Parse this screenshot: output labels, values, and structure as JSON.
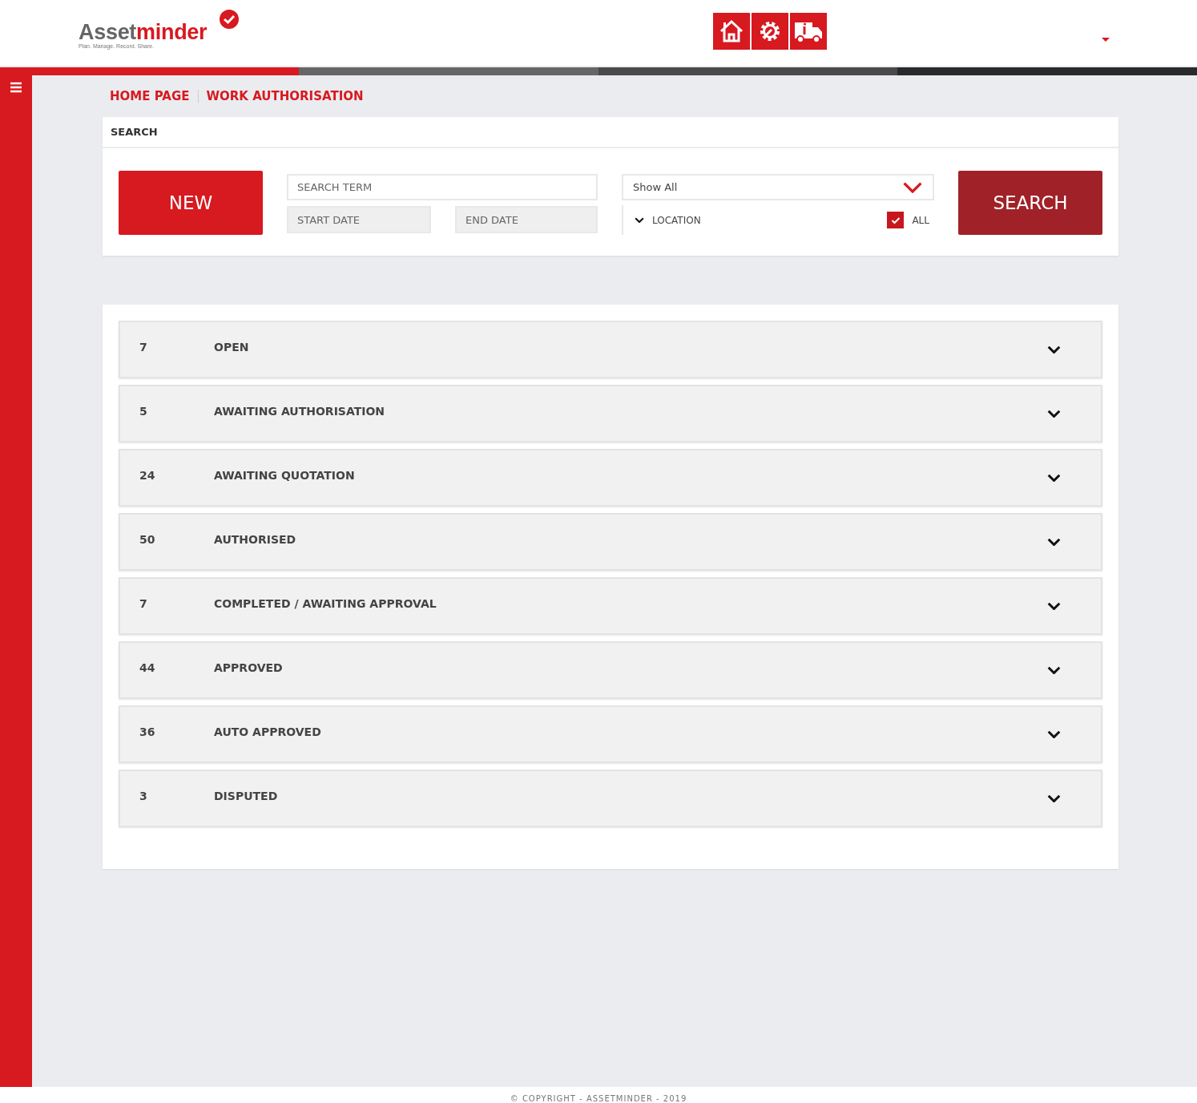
{
  "header": {
    "logo": {
      "name_start": "Asset",
      "name_end": "minder",
      "tagline": "Plan. Manage. Record. Share."
    }
  },
  "breadcrumb": [
    "HOME PAGE",
    "WORK AUTHORISATION"
  ],
  "search": {
    "title": "SEARCH",
    "new_button": "NEW",
    "search_term": {
      "placeholder": "SEARCH TERM"
    },
    "start_date": {
      "placeholder": "START DATE"
    },
    "end_date": {
      "placeholder": "END DATE"
    },
    "filter": {
      "value": "Show All"
    },
    "location": {
      "label": "LOCATION"
    },
    "all_checkbox": {
      "label": "ALL",
      "checked": true
    },
    "search_button": "SEARCH"
  },
  "statuses": [
    {
      "count": "7",
      "label": "OPEN",
      "expanded": false
    },
    {
      "count": "5",
      "label": "AWAITING AUTHORISATION",
      "expanded": false
    },
    {
      "count": "24",
      "label": "AWAITING QUOTATION",
      "expanded": false
    },
    {
      "count": "50",
      "label": "AUTHORISED",
      "expanded": false
    },
    {
      "count": "7",
      "label": "COMPLETED / AWAITING APPROVAL",
      "expanded": false
    },
    {
      "count": "44",
      "label": "APPROVED",
      "expanded": false
    },
    {
      "count": "36",
      "label": "AUTO APPROVED",
      "expanded": false
    },
    {
      "count": "3",
      "label": "DISPUTED",
      "expanded": false
    }
  ],
  "footer": "© COPYRIGHT - ASSETMINDER - 2019"
}
